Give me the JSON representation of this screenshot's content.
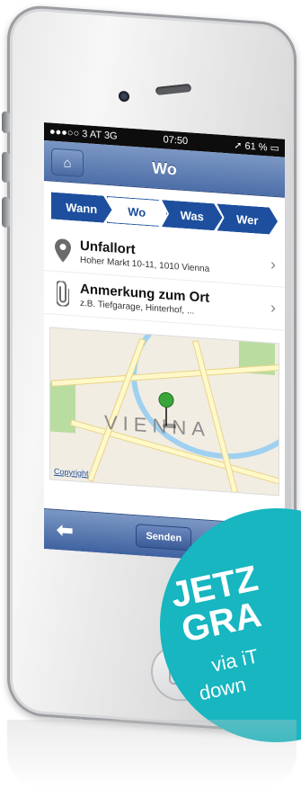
{
  "statusbar": {
    "carrier": "●●●○○ 3 AT  3G",
    "time": "07:50",
    "battery": "➚ 61 % ▭"
  },
  "navbar": {
    "title": "Wo",
    "home_icon": "home-icon"
  },
  "steps": [
    {
      "label": "Wann",
      "active": false
    },
    {
      "label": "Wo",
      "active": true
    },
    {
      "label": "Was",
      "active": false
    },
    {
      "label": "Wer",
      "active": false
    }
  ],
  "rows": [
    {
      "title": "Unfallort",
      "subtitle": "Hoher Markt 10-11, 1010 Vienna",
      "icon": "location-pin-icon"
    },
    {
      "title": "Anmerkung zum Ort",
      "subtitle": "z.B. Tiefgarage, Hinterhof, ...",
      "icon": "paperclip-icon"
    }
  ],
  "map": {
    "city_label": "VIENNA",
    "copyright": "Copyright"
  },
  "bottombar": {
    "back_icon": "back-arrow-icon",
    "send_label": "Senden"
  },
  "badge": {
    "line1": "JETZ",
    "line2": "GRA",
    "line3": "via iT",
    "line4": "down"
  },
  "colors": {
    "accent": "#1d4f9e",
    "navbar": "#5c7bb3",
    "badge": "#17b6c0"
  }
}
